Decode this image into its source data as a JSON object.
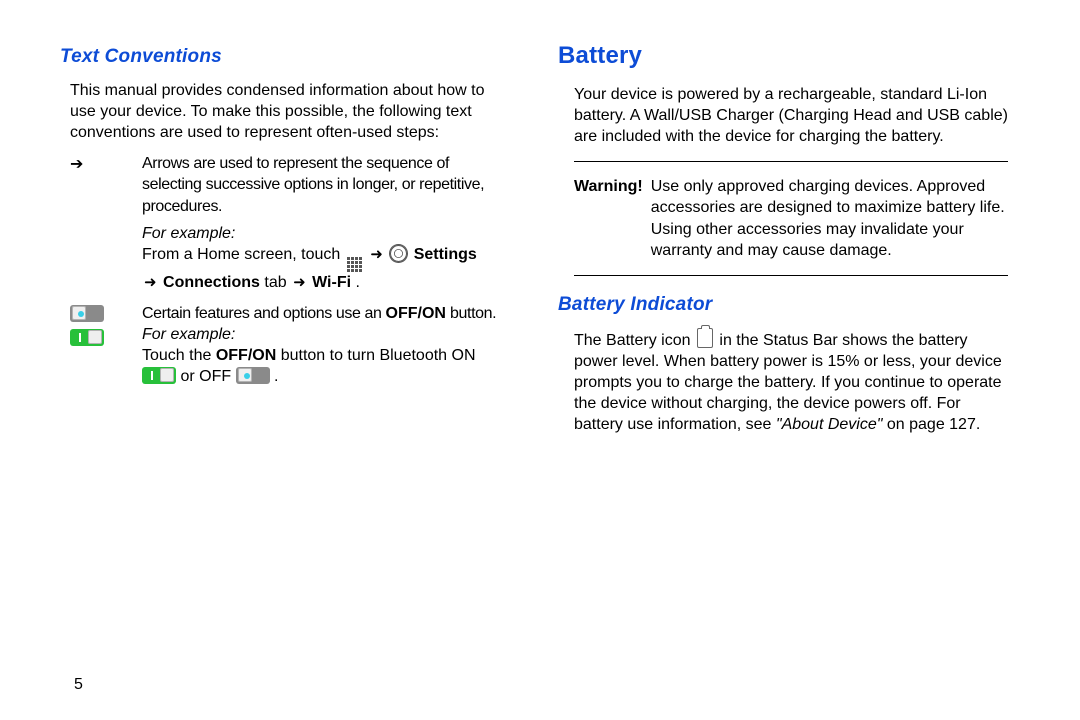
{
  "page_number": "5",
  "left": {
    "heading": "Text Conventions",
    "intro": "This manual provides condensed information about how to use your device. To make this possible, the following text conventions are used to represent often-used steps:",
    "arrow_desc": "Arrows are used to represent the sequence of selecting successive options in longer, or repetitive, procedures.",
    "for_example": "For example:",
    "example1_pre": "From a Home screen, touch ",
    "example1_settings": " Settings",
    "example1_connections": " Connections",
    "example1_tab": " tab ",
    "example1_wifi": " Wi-Fi",
    "example1_end": ".",
    "offon_desc_pre": "Certain features and options use an ",
    "offon_bold": "OFF/ON",
    "offon_desc_post": " button.",
    "for_example2": "For example:",
    "example2_pre": "Touch the ",
    "example2_bold": "OFF/ON",
    "example2_mid": " button to turn Bluetooth ON",
    "example2_or": " or OFF ",
    "example2_end": "."
  },
  "right": {
    "heading1": "Battery",
    "battery_desc": "Your device is powered by a rechargeable, standard Li-Ion battery. A Wall/USB Charger (Charging Head and USB cable) are included with the device for charging the battery.",
    "warning_label": "Warning!",
    "warning_text": "Use only approved charging devices. Approved accessories are designed to maximize battery life. Using other accessories may invalidate your warranty and may cause damage.",
    "heading2": "Battery Indicator",
    "indicator_pre": "The Battery icon ",
    "indicator_mid": " in the Status Bar shows the battery power level. When battery power is 15% or less, your device prompts you to charge the battery. If you continue to operate the device without charging, the device powers off. For battery use information, see ",
    "indicator_ref": "\"About Device\"",
    "indicator_post": " on page 127."
  }
}
